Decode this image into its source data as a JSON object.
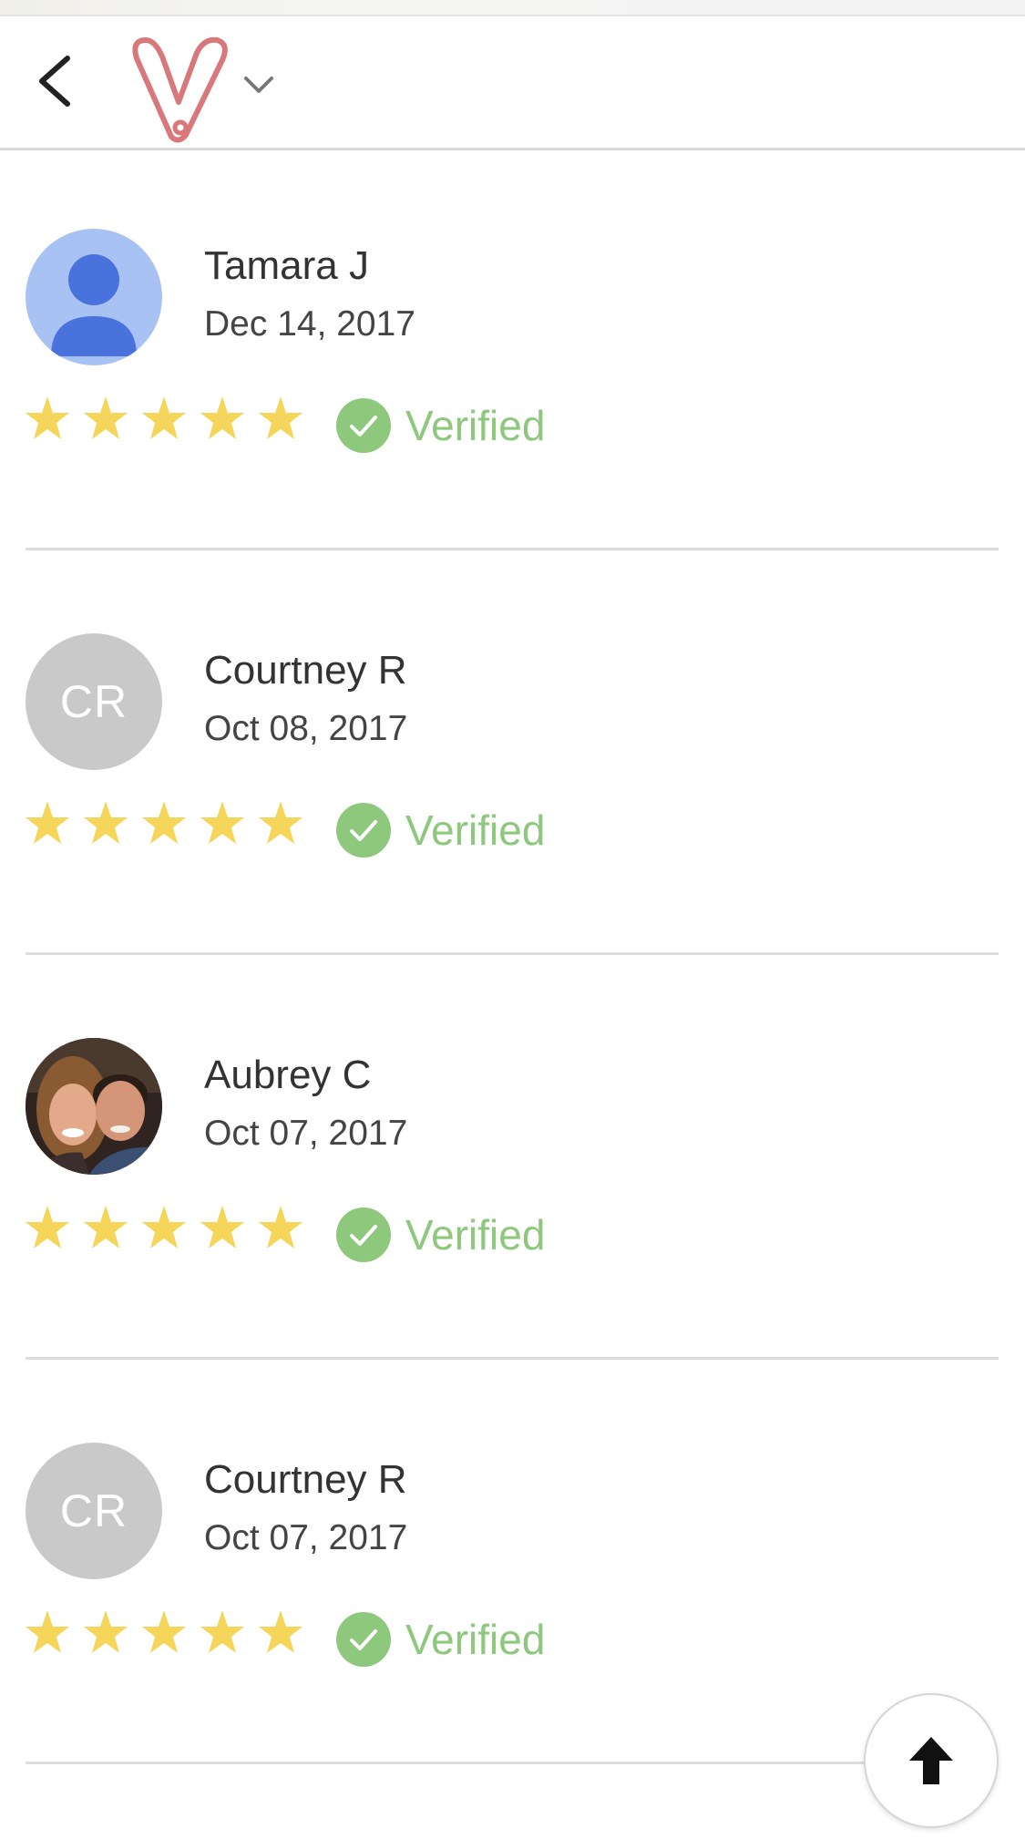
{
  "header": {
    "back_icon": "chevron-left-icon",
    "logo_icon": "v-brand-logo-icon",
    "menu_icon": "chevron-down-icon"
  },
  "colors": {
    "star": "#f5d55a",
    "verified": "#8dc87d",
    "logo": "#d8787a",
    "initials_avatar": "#c9c9c9",
    "generic_avatar": "#a8c2f4"
  },
  "reviews": [
    {
      "name": "Tamara J",
      "date": "Dec 14, 2017",
      "avatar_type": "generic-person-icon",
      "initials": "",
      "rating": 5,
      "verified_label": "Verified"
    },
    {
      "name": "Courtney R",
      "date": "Oct 08, 2017",
      "avatar_type": "initials",
      "initials": "CR",
      "rating": 5,
      "verified_label": "Verified"
    },
    {
      "name": "Aubrey C",
      "date": "Oct 07, 2017",
      "avatar_type": "photo",
      "initials": "",
      "rating": 5,
      "verified_label": "Verified"
    },
    {
      "name": "Courtney R",
      "date": "Oct 07, 2017",
      "avatar_type": "initials",
      "initials": "CR",
      "rating": 5,
      "verified_label": "Verified"
    }
  ],
  "scroll_top_icon": "arrow-up-icon"
}
